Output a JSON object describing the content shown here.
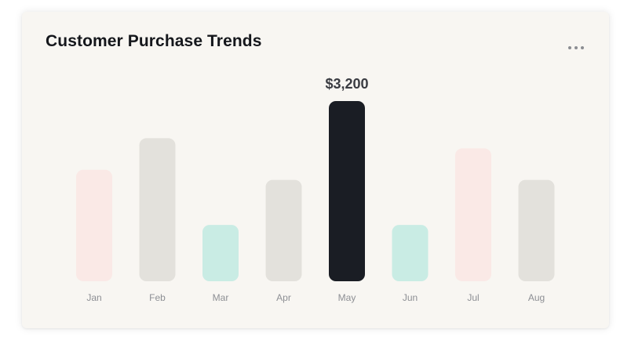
{
  "card": {
    "title": "Customer Purchase Trends",
    "menu_icon": "more-horizontal-icon"
  },
  "chart_data": {
    "type": "bar",
    "title": "Customer Purchase Trends",
    "xlabel": "",
    "ylabel": "",
    "ylim": [
      0,
      3200
    ],
    "grid": false,
    "legend": "none",
    "categories": [
      "Jan",
      "Feb",
      "Mar",
      "Apr",
      "May",
      "Jun",
      "Jul",
      "Aug"
    ],
    "values": [
      1980,
      2540,
      1000,
      1800,
      3200,
      1000,
      2360,
      1800
    ],
    "colors": [
      "#fae9e6",
      "#e3e1dc",
      "#c9ece4",
      "#e3e1dc",
      "#1a1d24",
      "#c9ece4",
      "#fae9e6",
      "#e3e1dc"
    ],
    "annotations": [
      {
        "category": "May",
        "text": "$3,200"
      }
    ]
  }
}
